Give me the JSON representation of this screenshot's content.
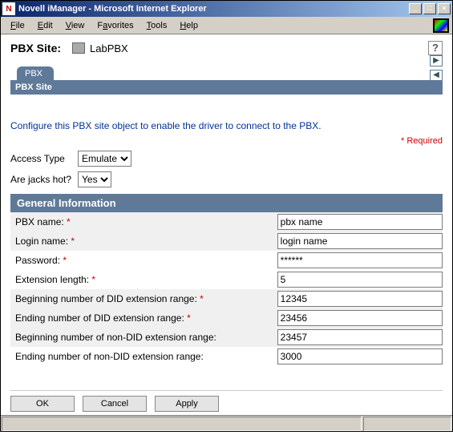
{
  "window": {
    "title": "Novell iManager - Microsoft Internet Explorer"
  },
  "menu": {
    "file": "File",
    "edit": "Edit",
    "view": "View",
    "favorites": "Favorites",
    "tools": "Tools",
    "help": "Help"
  },
  "pbx": {
    "site_label": "PBX Site:",
    "site_value": "LabPBX",
    "help": "?"
  },
  "tabs": {
    "pbx": "PBX",
    "subheader": "PBX Site",
    "nav_right": "▶",
    "nav_left": "◀"
  },
  "desc": "Configure this PBX site object to enable the driver to connect to the PBX.",
  "required_label": "* Required",
  "form": {
    "access_type_label": "Access Type",
    "access_type_value": "Emulate",
    "jacks_label": "Are jacks hot?",
    "jacks_value": "Yes"
  },
  "section": {
    "general_info": "General Information"
  },
  "fields": {
    "pbx_name": {
      "label": "PBX name:",
      "value": "pbx name",
      "req": "*"
    },
    "login_name": {
      "label": "Login name:",
      "value": "login name",
      "req": "*"
    },
    "password": {
      "label": "Password:",
      "value": "******",
      "req": "*"
    },
    "ext_len": {
      "label": "Extension length:",
      "value": "5",
      "req": "*"
    },
    "did_begin": {
      "label": "Beginning number of DID extension range:",
      "value": "12345",
      "req": "*"
    },
    "did_end": {
      "label": "Ending number of DID extension range:",
      "value": "23456",
      "req": "*"
    },
    "non_did_begin": {
      "label": "Beginning number of non-DID extension range:",
      "value": "23457"
    },
    "non_did_end": {
      "label": "Ending number of non-DID extension range:",
      "value": "3000"
    }
  },
  "buttons": {
    "ok": "OK",
    "cancel": "Cancel",
    "apply": "Apply"
  }
}
